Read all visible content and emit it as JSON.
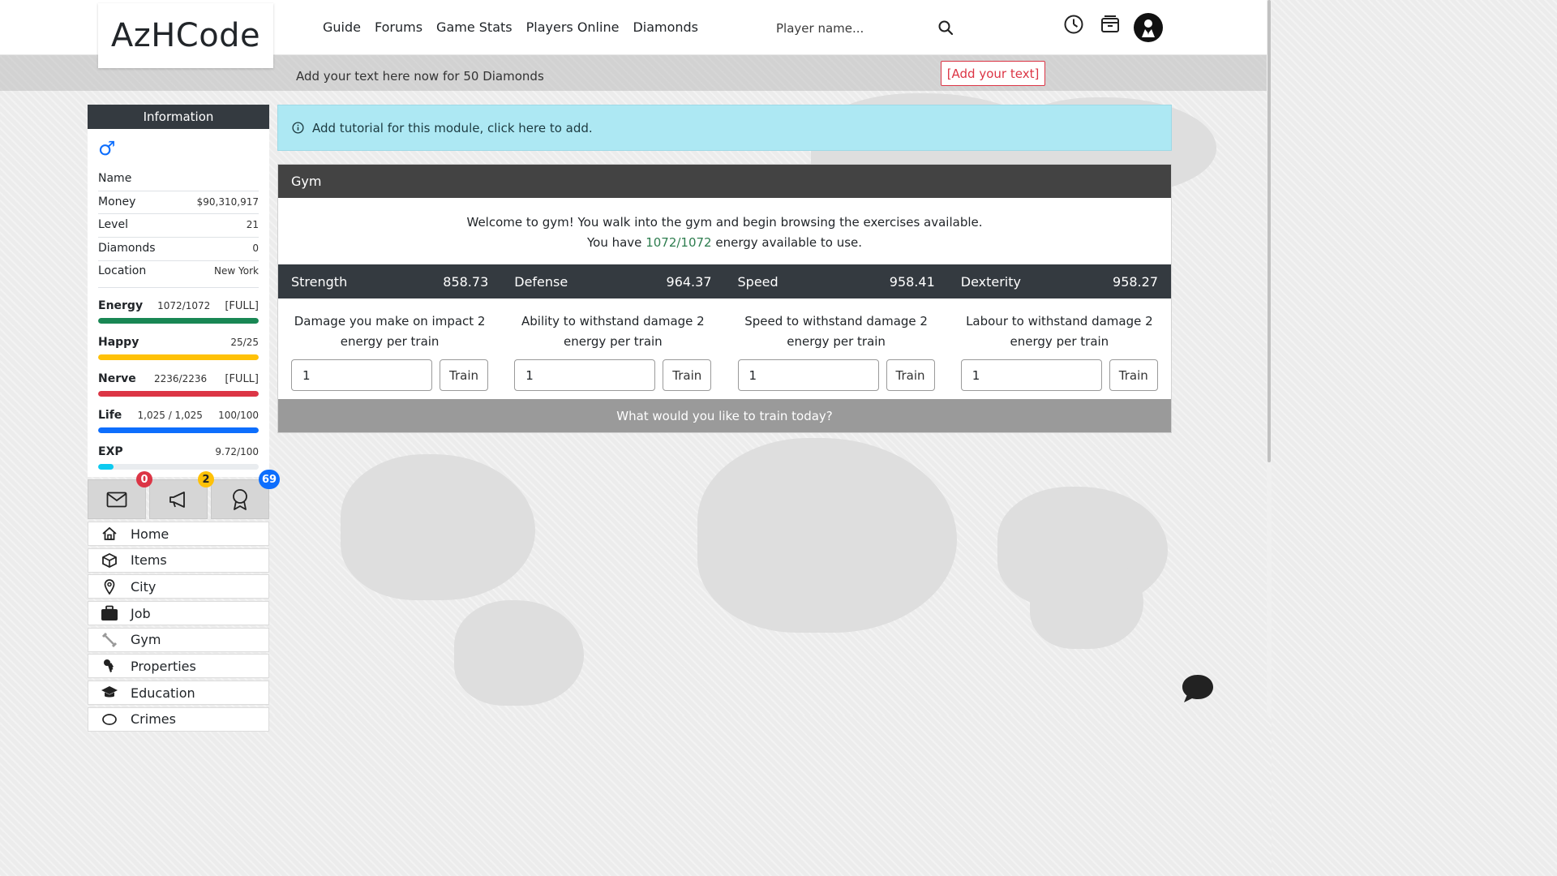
{
  "brand": {
    "logo_text": "AzHCode"
  },
  "nav": [
    "Guide",
    "Forums",
    "Game Stats",
    "Players Online",
    "Diamonds"
  ],
  "search": {
    "placeholder": "Player name..."
  },
  "ad": {
    "text": "Add your text here now for 50 Diamonds",
    "button_label": "[Add your text]"
  },
  "sidebar": {
    "title": "Information",
    "gender_symbol": "♂",
    "fields": [
      {
        "label": "Name",
        "value": ""
      },
      {
        "label": "Money",
        "value": "$90,310,917"
      },
      {
        "label": "Level",
        "value": "21"
      },
      {
        "label": "Diamonds",
        "value": "0"
      },
      {
        "label": "Location",
        "value": "New York"
      }
    ],
    "stats": [
      {
        "name": "Energy",
        "value": "1072/1072",
        "status": "[FULL]",
        "fill": 1.0,
        "color": "#198754"
      },
      {
        "name": "Happy",
        "value": "",
        "status": "25/25",
        "fill": 1.0,
        "color": "#ffc107"
      },
      {
        "name": "Nerve",
        "value": "2236/2236",
        "status": "[FULL]",
        "fill": 1.0,
        "color": "#dc3545"
      },
      {
        "name": "Life",
        "value": "1,025 / 1,025",
        "status": "100/100",
        "fill": 1.0,
        "color": "#0d6efd"
      },
      {
        "name": "EXP",
        "value": "",
        "status": "9.72/100",
        "fill": 0.0972,
        "color": "#0dcaf0"
      }
    ]
  },
  "quick": {
    "mail_count": "0",
    "announce_count": "2",
    "award_count": "69"
  },
  "menu": [
    "Home",
    "Items",
    "City",
    "Job",
    "Gym",
    "Properties",
    "Education",
    "Crimes"
  ],
  "tutorial": {
    "text": "Add tutorial for this module, click here to add."
  },
  "gym": {
    "title": "Gym",
    "welcome_line1": "Welcome to gym! You walk into the gym and begin browsing the exercises available.",
    "welcome_prefix": "You have",
    "energy": "1072/1072",
    "welcome_suffix": "energy available to use.",
    "footer": "What would you like to train today?",
    "train_label": "Train",
    "attributes": [
      {
        "name": "Strength",
        "value": "858.73",
        "desc": "Damage you make on impact 2 energy per train",
        "input": "1"
      },
      {
        "name": "Defense",
        "value": "964.37",
        "desc": "Ability to withstand damage 2 energy per train",
        "input": "1"
      },
      {
        "name": "Speed",
        "value": "958.41",
        "desc": "Speed to withstand damage 2 energy per train",
        "input": "1"
      },
      {
        "name": "Dexterity",
        "value": "958.27",
        "desc": "Labour to withstand damage 2 energy per train",
        "input": "1"
      }
    ]
  },
  "icons": {
    "search": "search-icon",
    "clock": "clock-icon",
    "inbox": "inbox-icon",
    "avatar": "avatar-icon",
    "mail": "mail-icon",
    "megaphone": "megaphone-icon",
    "award": "award-icon",
    "home": "house-icon",
    "items": "box-icon",
    "city": "map-pin-icon",
    "job": "briefcase-icon",
    "gym": "dumbbell-icon",
    "properties": "key-icon",
    "education": "mortarboard-icon",
    "info": "info-circle-icon",
    "chat": "chat-bubble-icon"
  },
  "colors": {
    "primary": "#0d6efd",
    "info_bg": "#ade8f3",
    "dark": "#343a40",
    "success": "#2e7d4f",
    "danger": "#dc3545"
  }
}
